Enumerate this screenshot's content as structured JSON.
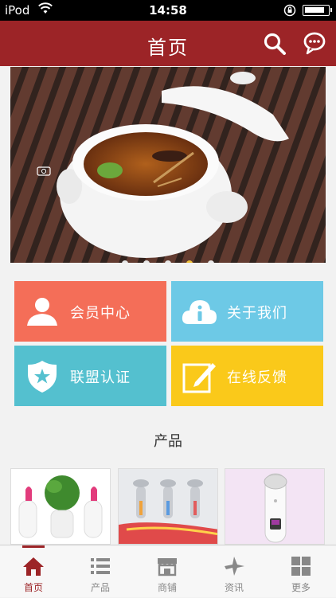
{
  "status": {
    "carrier": "iPod",
    "time": "14:58",
    "battery_level": 0.88
  },
  "header": {
    "title": "首页",
    "search_icon": "search-icon",
    "chat_icon": "chat-bubble-icon",
    "bg_color": "#9c2427"
  },
  "banner": {
    "image": "soup-tureen-photo",
    "slide_count": 5,
    "active_slide": 4
  },
  "tiles": [
    {
      "label": "会员中心",
      "icon": "user-icon",
      "color": "#f46e58"
    },
    {
      "label": "关于我们",
      "icon": "info-cloud-icon",
      "color": "#6dc9e6"
    },
    {
      "label": "联盟认证",
      "icon": "shield-star-icon",
      "color": "#54c0cf"
    },
    {
      "label": "在线反馈",
      "icon": "edit-icon",
      "color": "#fac91a"
    }
  ],
  "products": {
    "title": "产品",
    "items": [
      "facial-steamer-photo",
      "beauty-device-photo",
      "handheld-device-photo"
    ]
  },
  "tabbar": {
    "active_color": "#9c2427",
    "items": [
      {
        "label": "首页",
        "icon": "home-icon"
      },
      {
        "label": "产品",
        "icon": "list-icon"
      },
      {
        "label": "商铺",
        "icon": "store-icon"
      },
      {
        "label": "资讯",
        "icon": "plane-icon"
      },
      {
        "label": "更多",
        "icon": "grid-icon"
      }
    ]
  }
}
